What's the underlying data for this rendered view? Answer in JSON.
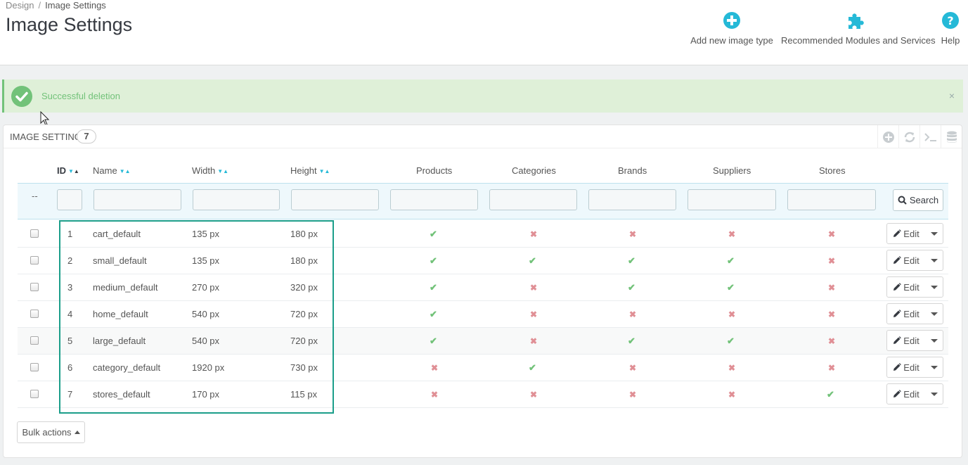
{
  "breadcrumb": {
    "parent": "Design",
    "separator": "/",
    "current": "Image Settings"
  },
  "page_title": "Image Settings",
  "toolbar": {
    "add": "Add new image type",
    "modules": "Recommended Modules and Services",
    "help": "Help"
  },
  "alert": {
    "message": "Successful deletion",
    "close": "×"
  },
  "panel": {
    "title": "Image Settings",
    "count": "7"
  },
  "columns": {
    "id": "ID",
    "name": "Name",
    "width": "Width",
    "height": "Height",
    "products": "Products",
    "categories": "Categories",
    "brands": "Brands",
    "suppliers": "Suppliers",
    "stores": "Stores"
  },
  "filter": {
    "placeholder_dash": "--",
    "search": "Search"
  },
  "row_actions": {
    "edit": "Edit"
  },
  "rows": [
    {
      "id": "1",
      "name": "cart_default",
      "width": "135 px",
      "height": "180 px",
      "products": true,
      "categories": false,
      "brands": false,
      "suppliers": false,
      "stores": false
    },
    {
      "id": "2",
      "name": "small_default",
      "width": "135 px",
      "height": "180 px",
      "products": true,
      "categories": true,
      "brands": true,
      "suppliers": true,
      "stores": false
    },
    {
      "id": "3",
      "name": "medium_default",
      "width": "270 px",
      "height": "320 px",
      "products": true,
      "categories": false,
      "brands": true,
      "suppliers": true,
      "stores": false
    },
    {
      "id": "4",
      "name": "home_default",
      "width": "540 px",
      "height": "720 px",
      "products": true,
      "categories": false,
      "brands": false,
      "suppliers": false,
      "stores": false
    },
    {
      "id": "5",
      "name": "large_default",
      "width": "540 px",
      "height": "720 px",
      "products": true,
      "categories": false,
      "brands": true,
      "suppliers": true,
      "stores": false
    },
    {
      "id": "6",
      "name": "category_default",
      "width": "1920 px",
      "height": "730 px",
      "products": false,
      "categories": true,
      "brands": false,
      "suppliers": false,
      "stores": false
    },
    {
      "id": "7",
      "name": "stores_default",
      "width": "170 px",
      "height": "115 px",
      "products": false,
      "categories": false,
      "brands": false,
      "suppliers": false,
      "stores": true
    }
  ],
  "bulk_actions": "Bulk actions",
  "colors": {
    "accent": "#25b9d7",
    "success": "#72c279",
    "danger": "#e08f95",
    "highlight": "#1b9e8a"
  }
}
